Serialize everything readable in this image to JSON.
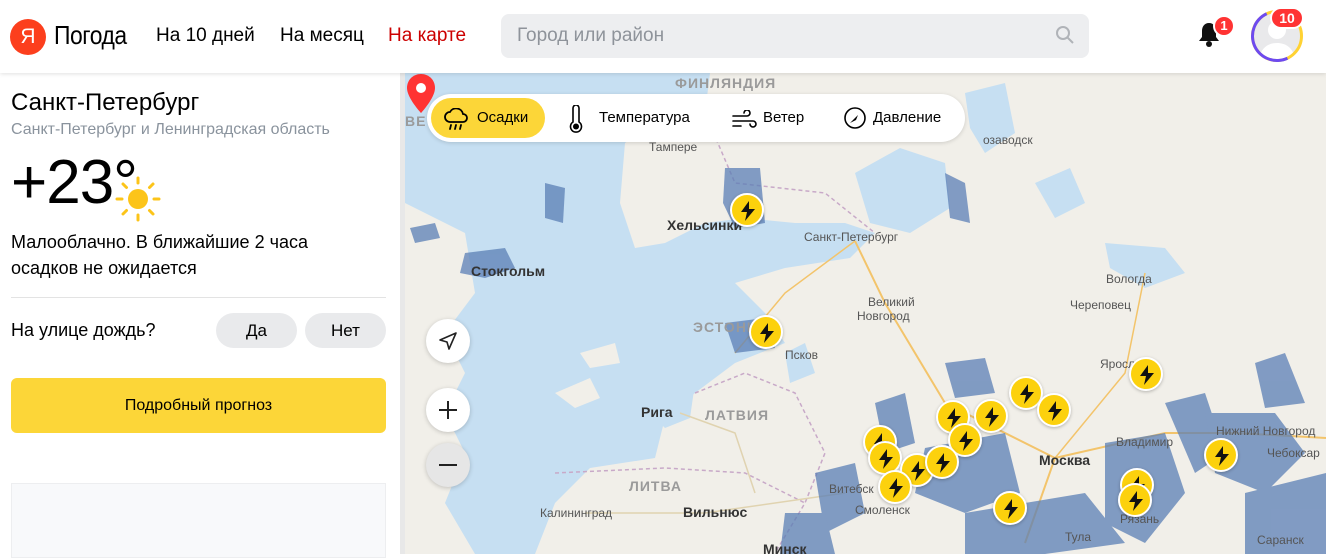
{
  "header": {
    "logo_mark": "Я",
    "logo_text": "Погода",
    "nav": [
      "На 10 дней",
      "На месяц",
      "На карте"
    ],
    "search_placeholder": "Город или район",
    "notifications_count": "1",
    "avatar_count": "10"
  },
  "panel": {
    "city": "Санкт-Петербург",
    "region": "Санкт-Петербург и Ленинградская область",
    "temperature": "+23°",
    "description": "Малооблачно. В ближайшие 2 часа осадков не ожидается",
    "rain_question": "На улице дождь?",
    "yes": "Да",
    "no": "Нет",
    "forecast_button": "Подробный прогноз"
  },
  "map": {
    "layers": [
      {
        "label": "Осадки",
        "icon": "rain-cloud-icon",
        "active": true
      },
      {
        "label": "Температура",
        "icon": "thermometer-icon",
        "active": false
      },
      {
        "label": "Ветер",
        "icon": "wind-icon",
        "active": false
      },
      {
        "label": "Давление",
        "icon": "pressure-gauge-icon",
        "active": false
      }
    ],
    "labels": {
      "finland": "ФИНЛЯНДИЯ",
      "helsinki": "Хельсинки",
      "tampere": "Тампере",
      "stockholm": "Стокгольм",
      "spb": "Санкт-Петербург",
      "novgorod_1": "Великий",
      "novgorod_2": "Новгород",
      "estonia": "ЭСТОНИЯ",
      "pskov": "Псков",
      "riga": "Рига",
      "latvia": "ЛАТВИЯ",
      "lithuania": "ЛИТВА",
      "vilnius": "Вильнюс",
      "kaliningrad": "Калининград",
      "moscow": "Москва",
      "vladimir": "Владимир",
      "n_novgorod": "Нижний Новгород",
      "cheboksary": "Чебоксар",
      "vologda": "Вологда",
      "cherepovets": "Череповец",
      "yaroslavl": "Яросл",
      "tula": "Тула",
      "saransk": "Саранск",
      "ryazan": "Рязань",
      "zavodsk": "озаводск",
      "vitebsk": "Витебск",
      "smolensk": "Смоленск",
      "we": "ВЕ",
      "minsk": "Минск"
    },
    "controls": [
      "geolocation-icon",
      "zoom-in-icon",
      "zoom-out-icon"
    ]
  },
  "colors": {
    "accent": "#fcd638",
    "brand": "#fc3f1d",
    "active_nav": "#cc0000",
    "precip": "#5b7fb5",
    "water": "#c6dff2"
  }
}
